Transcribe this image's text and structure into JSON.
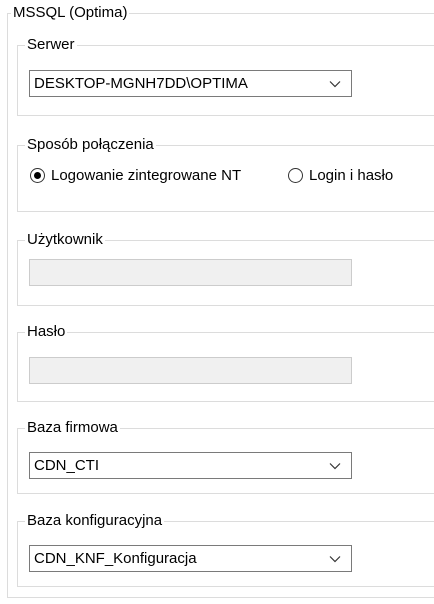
{
  "panel": {
    "title": "MSSQL (Optima)"
  },
  "server": {
    "label": "Serwer",
    "value": "DESKTOP-MGNH7DD\\OPTIMA"
  },
  "connection": {
    "label": "Sposób połączenia",
    "options": [
      {
        "label": "Logowanie zintegrowane NT",
        "checked": true
      },
      {
        "label": "Login i hasło",
        "checked": false
      }
    ]
  },
  "user": {
    "label": "Użytkownik",
    "value": ""
  },
  "password": {
    "label": "Hasło",
    "value": ""
  },
  "company_db": {
    "label": "Baza firmowa",
    "value": "CDN_CTI"
  },
  "config_db": {
    "label": "Baza konfiguracyjna",
    "value": "CDN_KNF_Konfiguracja"
  },
  "icons": {
    "dropdown": "chevron-down-icon"
  }
}
